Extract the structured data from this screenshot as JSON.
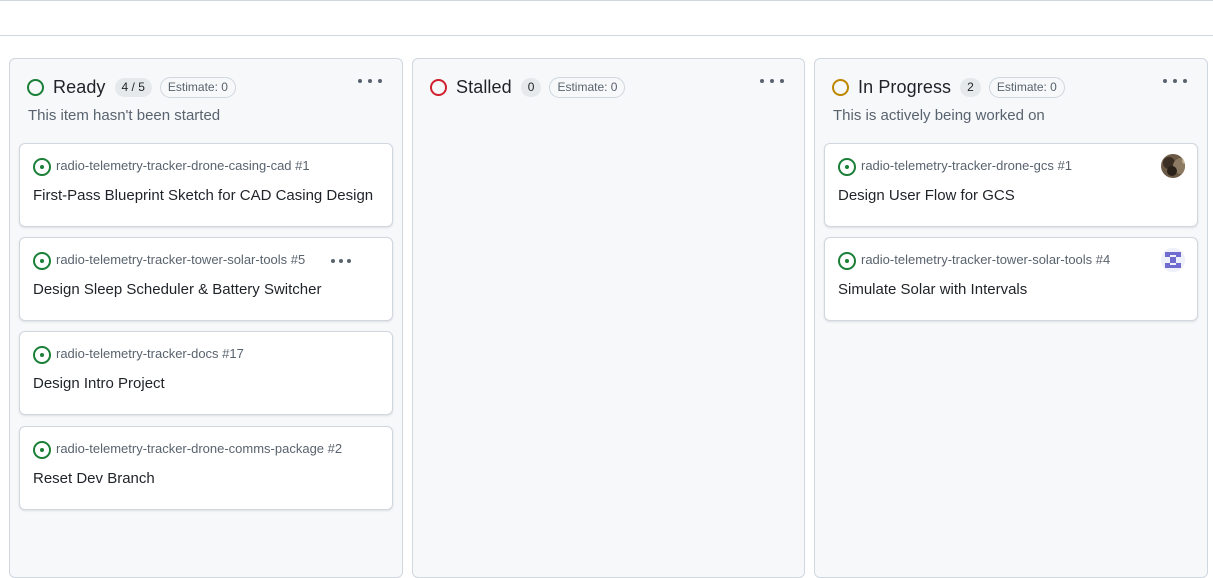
{
  "columns": [
    {
      "title": "Ready",
      "count": "4 / 5",
      "estimate": "Estimate: 0",
      "description": "This item hasn't been started",
      "status_color": "#1a7f37",
      "cards": [
        {
          "repo": "radio-telemetry-tracker-drone-casing-cad #1",
          "title": "First-Pass Blueprint Sketch for CAD Casing Design"
        },
        {
          "repo": "radio-telemetry-tracker-tower-solar-tools #5",
          "title": "Design Sleep Scheduler & Battery Switcher"
        },
        {
          "repo": "radio-telemetry-tracker-docs #17",
          "title": "Design Intro Project"
        },
        {
          "repo": "radio-telemetry-tracker-drone-comms-package #2",
          "title": "Reset Dev Branch"
        }
      ]
    },
    {
      "title": "Stalled",
      "count": "0",
      "estimate": "Estimate: 0",
      "description": "",
      "status_color": "#cf222e",
      "cards": []
    },
    {
      "title": "In Progress",
      "count": "2",
      "estimate": "Estimate: 0",
      "description": "This is actively being worked on",
      "status_color": "#bf8700",
      "cards": [
        {
          "repo": "radio-telemetry-tracker-drone-gcs #1",
          "title": "Design User Flow for GCS",
          "avatar": "photo"
        },
        {
          "repo": "radio-telemetry-tracker-tower-solar-tools #4",
          "title": "Simulate Solar with Intervals",
          "avatar": "identicon"
        }
      ]
    }
  ],
  "icons": {
    "issue": "issue-open-icon",
    "status_ring": "status-circle-icon",
    "menu": "kebab-horizontal-icon"
  },
  "colors": {
    "issue_open": "#1a7f37",
    "column_bg": "#f6f8fa",
    "border": "#d0d7de"
  }
}
